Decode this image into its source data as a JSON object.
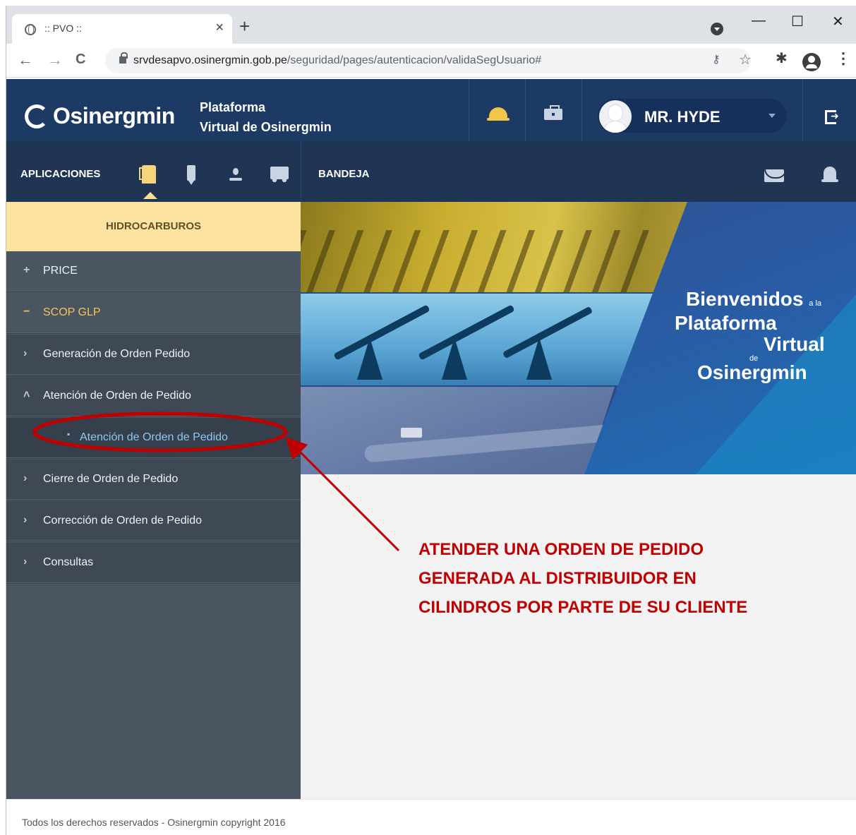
{
  "browser": {
    "tab_title": ":: PVO ::",
    "tab_close": "×",
    "new_tab": "+",
    "minimize": "—",
    "maximize": "☐",
    "close": "✕",
    "back": "←",
    "forward": "→",
    "reload": "C",
    "url_host": "srvdesapvo.osinergmin.gob.pe",
    "url_path": "/seguridad/pages/autenticacion/validaSegUsuario#",
    "key_icon": "key-icon",
    "star": "☆",
    "extensions": "✱",
    "menu": "⋮"
  },
  "header": {
    "logo": "Osinergmin",
    "platform_line1": "Plataforma",
    "platform_line2": "Virtual de Osinergmin",
    "user_name": "MR. HYDE"
  },
  "nav": {
    "apps_label": "APLICACIONES",
    "inbox_label": "BANDEJA"
  },
  "sidebar": {
    "section_title": "HIDROCARBUROS",
    "items": [
      {
        "mark": "+",
        "label": "PRICE"
      },
      {
        "mark": "−",
        "label": "SCOP GLP"
      },
      {
        "mark": "›",
        "label": "Generación de Orden Pedido"
      },
      {
        "mark": "˄",
        "label": "Atención de Orden de Pedido"
      },
      {
        "mark": "▪",
        "label": "Atención de Orden de Pedido"
      },
      {
        "mark": "›",
        "label": "Cierre de Orden de Pedido"
      },
      {
        "mark": "›",
        "label": "Corrección de Orden de Pedido"
      },
      {
        "mark": "›",
        "label": "Consultas"
      }
    ]
  },
  "banner": {
    "line1": "Bienvenidos",
    "line1_small": "a la",
    "line2": "Plataforma",
    "line3": "Virtual",
    "line3_small": "de",
    "line4": "Osinergmin"
  },
  "annotation": {
    "line1": "ATENDER UNA ORDEN DE PEDIDO",
    "line2": "GENERADA AL DISTRIBUIDOR EN",
    "line3": "CILINDROS POR PARTE DE SU CLIENTE",
    "color": "#c00000"
  },
  "footer": {
    "text": "Todos los derechos reservados - Osinergmin copyright 2016"
  }
}
